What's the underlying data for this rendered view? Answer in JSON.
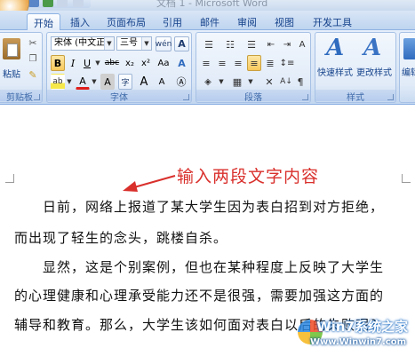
{
  "window": {
    "title": "文档 1 - Microsoft Word"
  },
  "tabs": [
    {
      "label": "开始",
      "active": true
    },
    {
      "label": "插入"
    },
    {
      "label": "页面布局"
    },
    {
      "label": "引用"
    },
    {
      "label": "邮件"
    },
    {
      "label": "审阅"
    },
    {
      "label": "视图"
    },
    {
      "label": "开发工具"
    }
  ],
  "ribbon": {
    "clipboard": {
      "label": "剪贴板",
      "paste_label": "粘贴"
    },
    "font": {
      "label": "字体",
      "font_name": "宋体 (中文正)",
      "font_size": "三号",
      "bold": "B",
      "italic": "I",
      "underline": "U",
      "strike": "abc",
      "subscript": "x₂",
      "superscript": "x²",
      "change_case": "Aa",
      "clear_format": "A",
      "font_color": "A",
      "char_shade": "A",
      "char_border": "A",
      "grow": "A",
      "shrink": "A",
      "phonetic": "wén",
      "enclose": "字"
    },
    "paragraph": {
      "label": "段落"
    },
    "styles": {
      "label": "样式",
      "quick_styles": "快速样式",
      "change_styles": "更改样式",
      "edit_label": "编辑"
    }
  },
  "document": {
    "paragraph1": [
      "日前，网络上报道了某大学生因为表白招到对方拒绝，",
      "而出现了轻生的念头，跳楼自杀。"
    ],
    "paragraph2": [
      "显然，这是个别案例，但也在某种程度上反映了大学生",
      "的心理健康和心理承受能力还不是很强，需要加强这方面的",
      "辅导和教育。那么，大学生该如何面对表白以后的失败呢？"
    ]
  },
  "annotation": {
    "text": "输入两段文字内容",
    "color": "#d9302c"
  },
  "watermark": {
    "site": "Win7系统之家",
    "url": "Www.Winwin7.com"
  }
}
